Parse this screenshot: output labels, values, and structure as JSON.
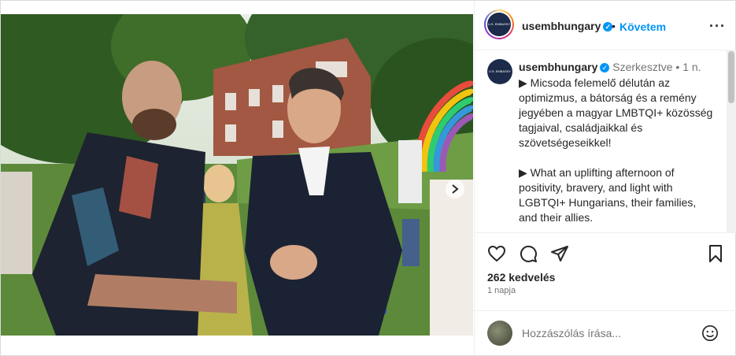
{
  "account": {
    "username": "usembhungary",
    "follow_label": "Követem",
    "avatar_text": "U.S. EMBASSY Budapest"
  },
  "caption": {
    "username": "usembhungary",
    "edited": "Szerkesztve",
    "time": "1 n.",
    "paragraphs": [
      "▶ Micsoda felemelő délután az optimizmus, a bátorság és a remény jegyében a magyar LMBTQI+ közösség tagjaival, családjaikkal és szövetségeseikkel!",
      "▶ What an uplifting afternoon of positivity, bravery, and light with LGBTQI+ Hungarians, their families, and their allies."
    ]
  },
  "likes": "262 kedvelés",
  "posted_ago": "1 napja",
  "comment_placeholder": "Hozzászólás írása...",
  "carousel": {
    "count": 9,
    "active_index": 0
  },
  "icons": [
    "verified-icon",
    "more-icon",
    "heart-icon",
    "comment-icon",
    "share-icon",
    "bookmark-icon",
    "emoji-icon",
    "chevron-right-icon"
  ],
  "colors": {
    "accent": "#0095f6",
    "text": "#262626",
    "muted": "#737373",
    "border": "#efefef"
  }
}
